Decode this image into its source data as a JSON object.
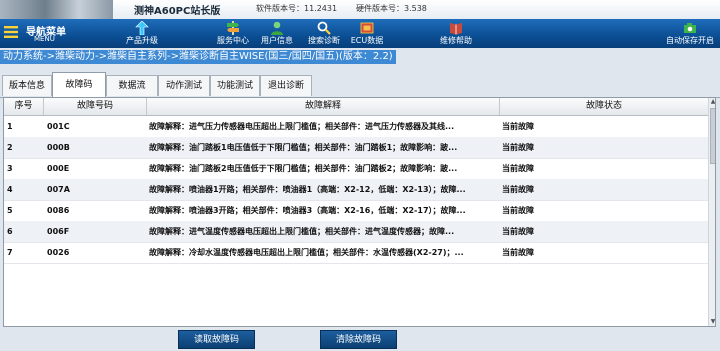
{
  "header": {
    "app_title": "测神A60PC站长版",
    "software_version": "软件版本号：11.2431",
    "hardware_version": "硬件版本号：3.538"
  },
  "toolbar": {
    "nav_menu": {
      "label": "导航菜单",
      "sub": "MENU",
      "icon": "menu-icon"
    },
    "buttons": [
      {
        "label": "产品升级",
        "icon": "upgrade-arrow-icon"
      },
      {
        "label": "服务中心",
        "icon": "signpost-icon"
      },
      {
        "label": "用户信息",
        "icon": "user-icon"
      },
      {
        "label": "搜索诊断",
        "icon": "search-icon"
      },
      {
        "label": "ECU数据",
        "icon": "ecu-icon"
      },
      {
        "label": "维修帮助",
        "icon": "book-icon"
      },
      {
        "label": "自动保存开启",
        "icon": "camera-icon"
      }
    ]
  },
  "breadcrumb": "动力系统->潍柴动力->潍柴自主系列->潍柴诊断自主WISE(国三/国四/国五)(版本：2.2)",
  "tabs": [
    "版本信息",
    "故障码",
    "数据流",
    "动作测试",
    "功能测试",
    "退出诊断"
  ],
  "active_tab": 1,
  "table": {
    "columns": [
      "序号",
      "故障号码",
      "故障解释",
      "故障状态"
    ],
    "rows": [
      {
        "idx": "1",
        "code": "001C",
        "desc": "故障解释：进气压力传感器电压超出上限门槛值；相关部件：进气压力传感器及其线...",
        "status": "当前故障"
      },
      {
        "idx": "2",
        "code": "000B",
        "desc": "故障解释：油门踏板1电压值低于下限门槛值；相关部件：油门踏板1；故障影响：跛...",
        "status": "当前故障"
      },
      {
        "idx": "3",
        "code": "000E",
        "desc": "故障解释：油门踏板2电压值低于下限门槛值；相关部件：油门踏板2；故障影响：跛...",
        "status": "当前故障"
      },
      {
        "idx": "4",
        "code": "007A",
        "desc": "故障解释：喷油器1开路；相关部件：喷油器1（高端：X2-12，低端：X2-13）；故障...",
        "status": "当前故障"
      },
      {
        "idx": "5",
        "code": "0086",
        "desc": "故障解释：喷油器3开路；相关部件：喷油器3（高端：X2-16，低端：X2-17）；故障...",
        "status": "当前故障"
      },
      {
        "idx": "6",
        "code": "006F",
        "desc": "故障解释：进气温度传感器电压超出上限门槛值；相关部件：进气温度传感器；故障...",
        "status": "当前故障"
      },
      {
        "idx": "7",
        "code": "0026",
        "desc": "故障解释：冷却水温度传感器电压超出上限门槛值；相关部件：水温传感器(X2-27)；...",
        "status": "当前故障"
      }
    ]
  },
  "actions": {
    "read_codes": "读取故障码",
    "clear_codes": "清除故障码"
  },
  "colors": {
    "toolbar": "#0b4e93",
    "breadcrumb": "#3e89d3",
    "button": "#0c3f72"
  }
}
